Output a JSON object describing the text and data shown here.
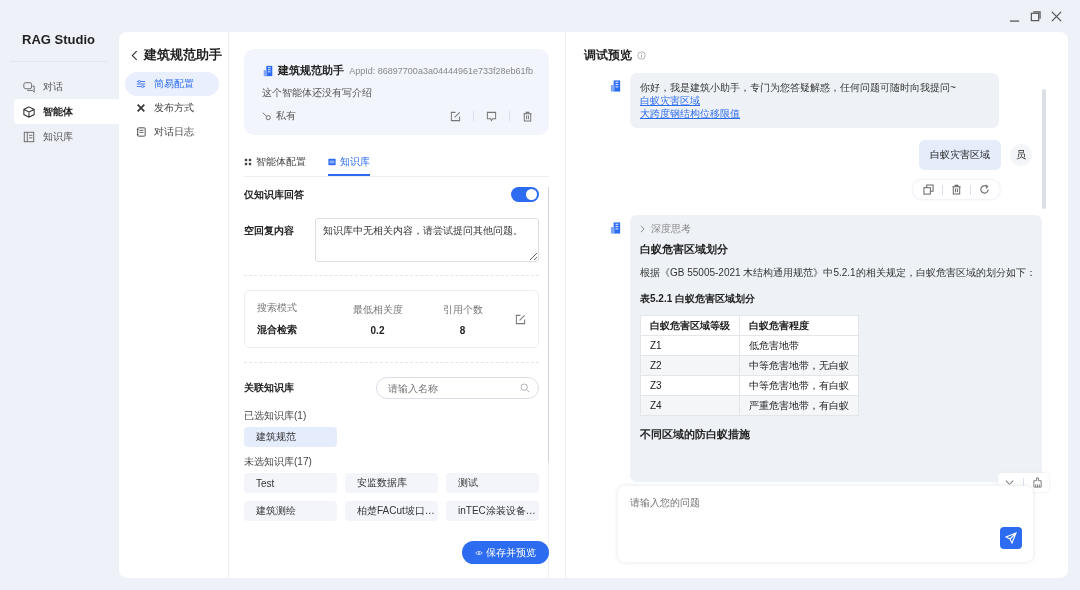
{
  "app": {
    "title": "RAG Studio"
  },
  "sidebar": {
    "items": [
      {
        "label": "对话",
        "selected": false
      },
      {
        "label": "智能体",
        "selected": true
      },
      {
        "label": "知识库",
        "selected": false
      }
    ]
  },
  "agent_nav": {
    "title": "建筑规范助手",
    "items": [
      {
        "label": "简易配置",
        "selected": true
      },
      {
        "label": "发布方式",
        "selected": false
      },
      {
        "label": "对话日志",
        "selected": false
      }
    ]
  },
  "agent_card": {
    "name": "建筑规范助手",
    "app_id": "AppId: 86897700a3a04444961e733f28eb61fb",
    "description": "这个智能体还没有写介绍",
    "visibility": "私有"
  },
  "config_tabs": [
    {
      "label": "智能体配置",
      "selected": false
    },
    {
      "label": "知识库",
      "selected": true
    }
  ],
  "kb_only_answer": {
    "label": "仅知识库回答",
    "on": true
  },
  "empty_reply": {
    "label": "空回复内容",
    "value": "知识库中无相关内容，请尝试提问其他问题。"
  },
  "search_settings": [
    {
      "label": "搜索模式",
      "value": "混合检索"
    },
    {
      "label": "最低相关度",
      "value": "0.2"
    },
    {
      "label": "引用个数",
      "value": "8"
    }
  ],
  "linked_kb": {
    "label": "关联知识库",
    "search_placeholder": "请输入名称",
    "selected_heading": "已选知识库(1)",
    "selected_items": [
      "建筑规范"
    ],
    "unselected_heading": "未选知识库(17)",
    "unselected_items": [
      "Test",
      "安监数据库",
      "测试",
      "建筑测绘",
      "柏楚FACut坡口…",
      "inTEC涂装设备…"
    ]
  },
  "save_button": "保存并预览",
  "preview": {
    "title": "调试预览",
    "greeting": {
      "text": "你好，我是建筑小助手，专门为您答疑解惑，任何问题可随时向我提问~",
      "links": [
        "白蚁灾害区域",
        "大跨度钢结构位移限值"
      ]
    },
    "user_message": {
      "text": "白蚁灾害区域",
      "avatar": "员"
    },
    "answer": {
      "thinking_label": "深度思考",
      "heading": "白蚁危害区域划分",
      "paragraph": "根据《GB 55005-2021 木结构通用规范》中5.2.1的相关规定，白蚁危害区域的划分如下：",
      "table_caption": "表5.2.1 白蚁危害区域划分",
      "table": {
        "columns": [
          "白蚁危害区域等级",
          "白蚁危害程度"
        ],
        "rows": [
          [
            "Z1",
            "低危害地带"
          ],
          [
            "Z2",
            "中等危害地带，无白蚁"
          ],
          [
            "Z3",
            "中等危害地带，有白蚁"
          ],
          [
            "Z4",
            "严重危害地带，有白蚁"
          ]
        ]
      },
      "subheading": "不同区域的防白蚁措施"
    },
    "input_placeholder": "请输入您的问题"
  }
}
